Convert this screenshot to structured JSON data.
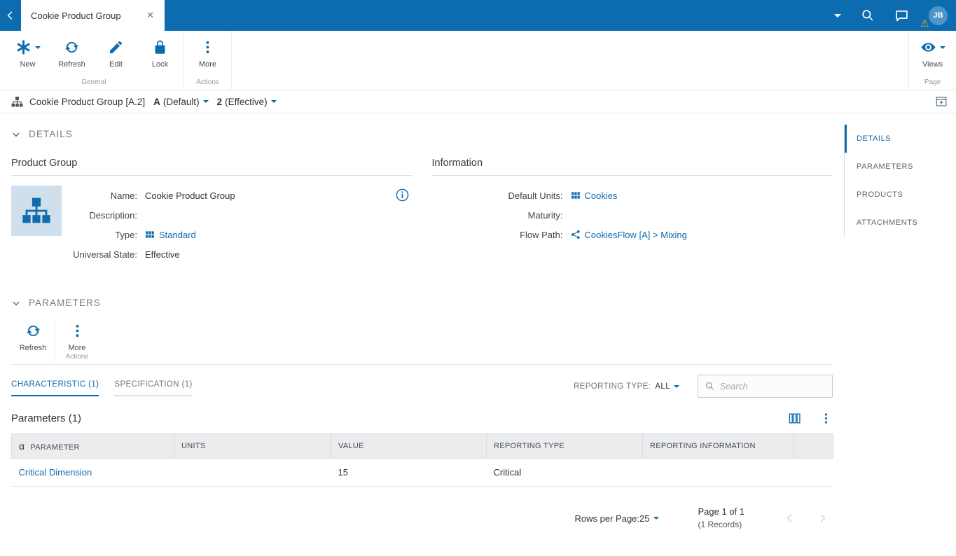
{
  "colors": {
    "topbar": "#0d6bb0",
    "accent": "#0e6cad",
    "warning": "#ffb400",
    "tile_bg": "#cfe0ec"
  },
  "topbar": {
    "tab_title": "Cookie Product Group",
    "avatar_initials": "JB"
  },
  "toolbar": {
    "new_label": "New",
    "refresh_label": "Refresh",
    "edit_label": "Edit",
    "lock_label": "Lock",
    "more_label": "More",
    "group_general": "General",
    "group_actions": "Actions",
    "views_label": "Views",
    "group_page": "Page"
  },
  "breadcrumb": {
    "title": "Cookie Product Group [A.2]",
    "version_letter": "A",
    "version_suffix": "(Default)",
    "revision_number": "2",
    "revision_suffix": "(Effective)"
  },
  "rightnav": {
    "items": [
      "DETAILS",
      "PARAMETERS",
      "PRODUCTS",
      "ATTACHMENTS"
    ]
  },
  "details": {
    "section_title": "DETAILS",
    "product_group": {
      "title": "Product Group",
      "name_label": "Name:",
      "name_value": "Cookie Product Group",
      "description_label": "Description:",
      "description_value": "",
      "type_label": "Type:",
      "type_value": "Standard",
      "state_label": "Universal State:",
      "state_value": "Effective"
    },
    "information": {
      "title": "Information",
      "units_label": "Default Units:",
      "units_value": "Cookies",
      "maturity_label": "Maturity:",
      "maturity_value": "",
      "flowpath_label": "Flow Path:",
      "flowpath_value": "CookiesFlow [A] > Mixing"
    }
  },
  "parameters": {
    "section_title": "PARAMETERS",
    "refresh_label": "Refresh",
    "more_label": "More",
    "group_actions": "Actions",
    "tabs": [
      {
        "label": "CHARACTERISTIC (1)"
      },
      {
        "label": "SPECIFICATION (1)"
      }
    ],
    "reporting_type_label": "REPORTING TYPE:",
    "reporting_type_value": "ALL",
    "search_placeholder": "Search",
    "grid_title": "Parameters (1)",
    "table": {
      "columns": [
        "PARAMETER",
        "UNITS",
        "VALUE",
        "REPORTING TYPE",
        "REPORTING INFORMATION"
      ],
      "rows": [
        {
          "parameter": "Critical Dimension",
          "units": "",
          "value": "15",
          "reporting_type": "Critical",
          "reporting_information": ""
        }
      ]
    },
    "pagination": {
      "rows_per_page_label": "Rows per Page:",
      "rows_per_page_value": "25",
      "page_text": "Page 1 of 1",
      "records_text": "(1 Records)"
    }
  }
}
